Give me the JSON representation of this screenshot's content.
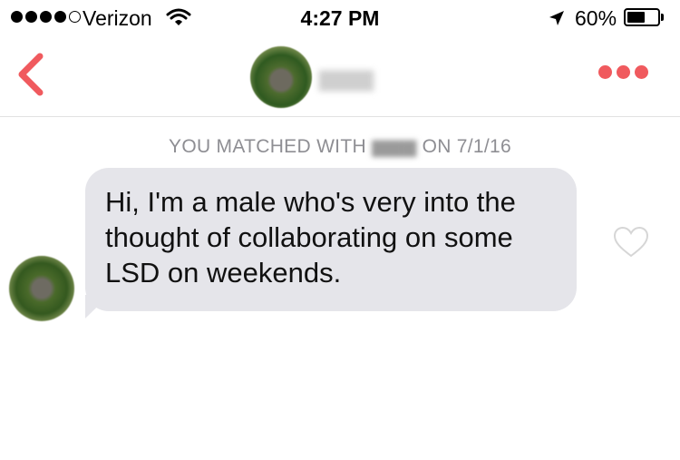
{
  "status_bar": {
    "carrier": "Verizon",
    "time": "4:27 PM",
    "battery_percent": "60%",
    "battery_level": 0.6,
    "signal_bars_filled": 4,
    "signal_bars_total": 5
  },
  "nav": {
    "back_icon": "chevron-left-icon",
    "more_icon": "ellipsis-icon",
    "accent_color": "#f05a5e"
  },
  "chat": {
    "match_prefix": "YOU MATCHED WITH",
    "match_suffix": "ON 7/1/16",
    "messages": [
      {
        "text": "Hi, I'm a male who's very into the thought of collaborating on some LSD on weekends.",
        "liked": false
      }
    ]
  }
}
